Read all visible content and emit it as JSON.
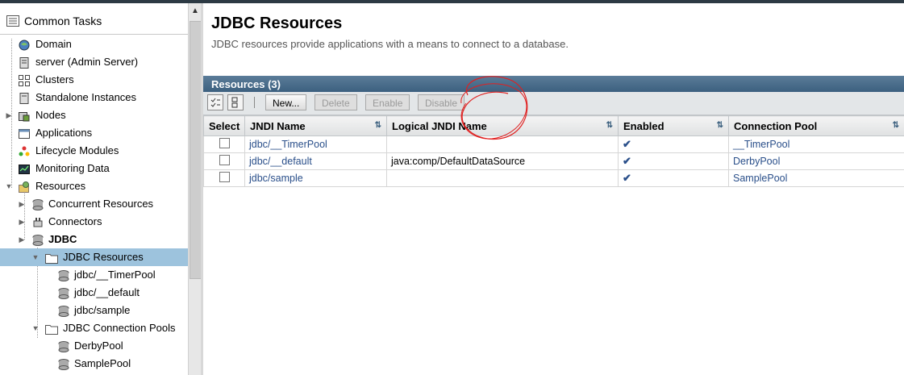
{
  "tree": {
    "header": "Common Tasks",
    "nodes": [
      {
        "label": "Domain",
        "icon": "globe-icon"
      },
      {
        "label": "server (Admin Server)",
        "icon": "server-icon"
      },
      {
        "label": "Clusters",
        "icon": "cluster-icon"
      },
      {
        "label": "Standalone Instances",
        "icon": "server-icon"
      },
      {
        "label": "Nodes",
        "icon": "node-icon"
      },
      {
        "label": "Applications",
        "icon": "applications-icon"
      },
      {
        "label": "Lifecycle Modules",
        "icon": "lifecycle-icon"
      },
      {
        "label": "Monitoring Data",
        "icon": "monitor-icon"
      },
      {
        "label": "Resources",
        "icon": "resources-icon"
      },
      {
        "label": "Concurrent Resources",
        "icon": "database-icon"
      },
      {
        "label": "Connectors",
        "icon": "connector-icon"
      },
      {
        "label": "JDBC",
        "icon": "database-icon"
      },
      {
        "label": "JDBC Resources",
        "icon": "folder-icon"
      },
      {
        "label": "jdbc/__TimerPool",
        "icon": "database-icon"
      },
      {
        "label": "jdbc/__default",
        "icon": "database-icon"
      },
      {
        "label": "jdbc/sample",
        "icon": "database-icon"
      },
      {
        "label": "JDBC Connection Pools",
        "icon": "folder-icon"
      },
      {
        "label": "DerbyPool",
        "icon": "database-icon"
      },
      {
        "label": "SamplePool",
        "icon": "database-icon"
      }
    ]
  },
  "page": {
    "title": "JDBC Resources",
    "description": "JDBC resources provide applications with a means to connect to a database."
  },
  "table": {
    "title": "Resources (3)",
    "buttons": {
      "new": "New...",
      "delete": "Delete",
      "enable": "Enable",
      "disable": "Disable"
    },
    "columns": [
      "Select",
      "JNDI Name",
      "Logical JNDI Name",
      "Enabled",
      "Connection Pool"
    ],
    "rows": [
      {
        "jndi": "jdbc/__TimerPool",
        "logical": "",
        "enabled": "✔",
        "pool": "__TimerPool"
      },
      {
        "jndi": "jdbc/__default",
        "logical": "java:comp/DefaultDataSource",
        "enabled": "✔",
        "pool": "DerbyPool"
      },
      {
        "jndi": "jdbc/sample",
        "logical": "",
        "enabled": "✔",
        "pool": "SamplePool"
      }
    ]
  },
  "colors": {
    "header_bar": "#3c607f",
    "selected_node": "#9dc3dd",
    "link": "#2a4f8a",
    "annotation": "#e02020"
  }
}
